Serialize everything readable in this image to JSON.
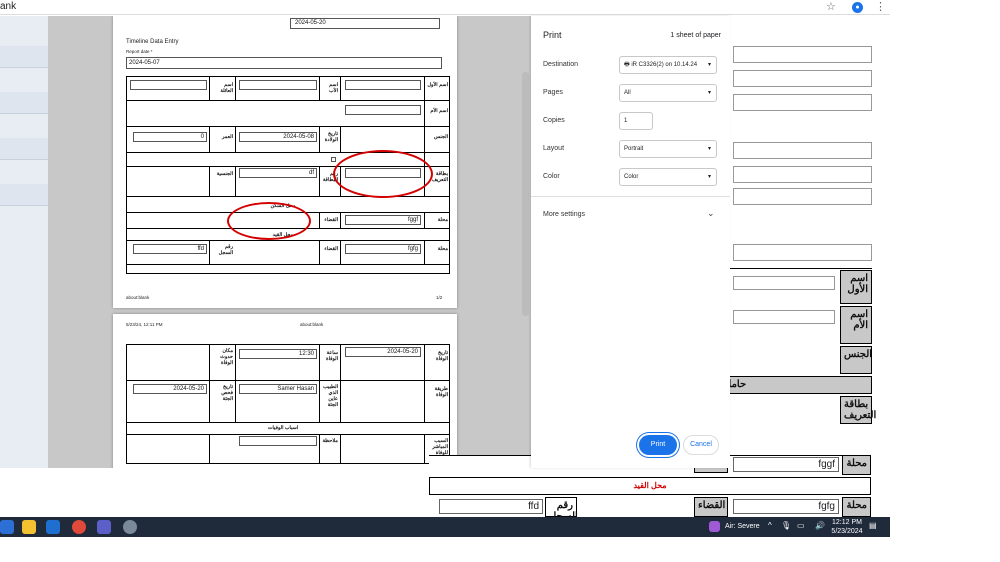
{
  "browser": {
    "url_fragment": "ank"
  },
  "page1": {
    "top_date": "2024-05-20",
    "section_title": "Timeline Data Entry",
    "report_date_label": "Report date *",
    "report_date": "2024-05-07",
    "lbl_first_name": "اسم الأول",
    "lbl_father_name": "اسم الأب",
    "lbl_family_name": "اسم العائلة",
    "lbl_mother_name": "اسم الأم",
    "lbl_gender": "الجنس",
    "lbl_birth_date": "تاريخ الولادة",
    "birth_date": "2024-05-08",
    "lbl_age": "العمر",
    "age": "0",
    "lbl_id_card": "بطاقة التعريف",
    "lbl_card_number": "رقم البطاقة",
    "card_number": "df",
    "lbl_nationality": "الجنسية",
    "lbl_residence": "محل السكن",
    "lbl_locality": "محلة",
    "locality": "fggf",
    "lbl_district": "القضاء",
    "lbl_registry": "محل القيد",
    "locality2": "fgfg",
    "lbl_district2": "القضاء",
    "registry_number": "ffd",
    "lbl_registry_number": "رقم السجل",
    "footer_left": "about:blank",
    "footer_right": "1/2"
  },
  "page2": {
    "header_left": "5/23/24, 12:11 PM",
    "header_center": "about:blank",
    "lbl_death_date": "تاريخ الوفاة",
    "death_date": "2024-05-20",
    "lbl_death_time": "ساعة الوفاة",
    "death_time": "12:30",
    "lbl_death_place": "مكان حدوث الوفاة",
    "lbl_death_method": "طريقة الوفاة",
    "lbl_doctor": "الطبيب الذي عاين الجثة",
    "doctor": "Samer Hasan",
    "lbl_exam_date": "تاريخ فحص الجثة",
    "exam_date": "2024-05-20",
    "lbl_causes": "اسباب الوفيات",
    "lbl_direct_cause": "السبب المباشر للوفاة",
    "lbl_notes": "ملاحظة"
  },
  "dialog": {
    "title": "Print",
    "sheets": "1 sheet of paper",
    "destination_label": "Destination",
    "destination_value": "iR C3326(2) on 10.14.24",
    "pages_label": "Pages",
    "pages_value": "All",
    "copies_label": "Copies",
    "copies_value": "1",
    "layout_label": "Layout",
    "layout_value": "Portrait",
    "color_label": "Color",
    "color_value": "Color",
    "more_settings": "More settings",
    "print_button": "Print",
    "cancel_button": "Cancel"
  },
  "underlying": {
    "lbl_first_name": "اسم الأول",
    "lbl_mother_name": "اسم الأم",
    "lbl_gender": "الجنس",
    "lbl_pregnant": "حامل",
    "lbl_id_card": "بطاقة التعريف",
    "lbl_locality": "محلة",
    "locality": "fggf",
    "lbl_district": "القضاء",
    "lbl_registry": "محل القيد",
    "lbl_locality2": "محلة",
    "locality2": "fgfg",
    "lbl_district2": "القضاء",
    "registry_number": "ffd",
    "lbl_registry_number": "رقم السجل"
  },
  "taskbar": {
    "weather": "Air: Severe",
    "time": "12:12 PM",
    "date": "5/23/2024"
  },
  "colors": {
    "accent": "#1a73e8",
    "annotation": "#d40000",
    "taskbar": "#1f2a3a"
  }
}
